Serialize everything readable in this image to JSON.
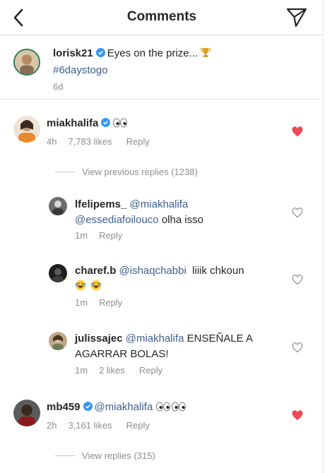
{
  "header": {
    "title": "Comments",
    "back_icon": "chevron-left-icon",
    "send_icon": "paper-plane-icon"
  },
  "caption": {
    "username": "lorisk21",
    "text": "Eyes on the prize...",
    "hashtag": "#6daystogo",
    "time": "6d"
  },
  "comments": [
    {
      "username": "miakhalifa",
      "verified": true,
      "text": "",
      "emoji": "👀",
      "time": "4h",
      "likes": "7,783 likes",
      "reply_label": "Reply",
      "liked": true,
      "view_replies": "View previous replies (1238)"
    },
    {
      "username": "lfelipems_",
      "mention1": "@miakhalifa",
      "mention2": "@essediafoilouco",
      "text": "olha isso",
      "time": "1m",
      "reply_label": "Reply",
      "liked": false
    },
    {
      "username": "charef.b",
      "mention1": "@ishaqchabbi",
      "text": "liiik chkoun",
      "time": "1m",
      "reply_label": "Reply",
      "liked": false
    },
    {
      "username": "julissajec",
      "mention1": "@miakhalifa",
      "text": "ENSEÑALE A",
      "text2": "AGARRAR BOLAS!",
      "time": "1m",
      "likes": "2 likes",
      "reply_label": "Reply",
      "liked": false
    },
    {
      "username": "mb459",
      "verified": true,
      "mention1": "@miakhalifa",
      "time": "2h",
      "likes": "3,161 likes",
      "reply_label": "Reply",
      "liked": true,
      "view_replies": "View replies (315)"
    }
  ],
  "colors": {
    "mention": "#3f5f8f",
    "verified": "#3897f0",
    "heart_liked": "#ed4956",
    "meta": "#8e8e8e"
  }
}
